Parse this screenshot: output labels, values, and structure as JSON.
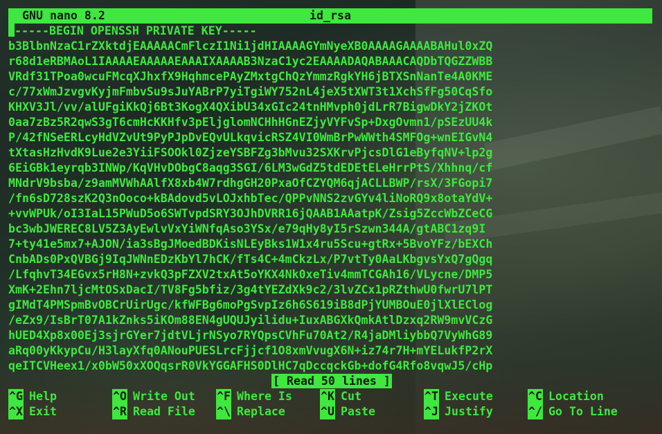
{
  "titlebar": {
    "app": "GNU nano 8.2",
    "filename": "id_rsa"
  },
  "editor": {
    "lines": [
      "-----BEGIN OPENSSH PRIVATE KEY-----",
      "b3BlbnNzaC1rZXktdjEAAAAACmFlczI1Ni1jdHIAAAAGYmNyeXB0AAAAGAAAABAHul0xZQ",
      "r68d1eRBMAoL1IAAAAEAAAAAEAAAIXAAAAB3NzaC1yc2EAAAADAQABAAACAQDbTQGZZWBB",
      "VRdf31TPoa0wcuFMcqXJhxfX9HqhmcePAyZMxtgChQzYmmzRgkYH6jBTXSnNanTe4A0KME",
      "c/77xWmJzvgvKyjmFmbvSu9sJuYABrP7yiTgiWY752nL4jeX5tXWT3t1XchSfFg50CqSfo",
      "KHXV3Jl/vv/alUFgiKkQj6Bt3KogX4QXibU34xGIc24tnHMvph0jdLrR7BigwDkY2jZKOt",
      "0aa7zBz5R2qwS3gT6cmHcKKHfv3pEljglomNCHhHGnEZjyVYFvSp+DxgOvmn1/pSEzUU4k",
      "P/42fNSeERLcyHdVZvUt9PyPJpDvEQvULkqvicRSZ4VI0WmBrPwWWth4SMFOg+wnEIGvN4",
      "tXtasHzHvdK9Lue2e3YiiFSOOkl0ZjzeYSBFZg3bMvu32SXKrvPjcsDlG1eByfqNV+lp2g",
      "6EiGBk1eyrqb3INWp/KqVHvDObgC8aqg3SGI/6LM3wGdZ5tdEDEtELeHrrPtS/Xhhnq/cf",
      "MNdrV9bsba/z9amMVWhAAlfX8xb4W7rdhgGH20PxaOfCZYQM6qjACLLBWP/rsX/3FGopi7",
      "/fn6sD728szK2Q3nOoco+kBAdovd5vLOJxhbTec/QPPvNNS2zvGYv4liNoRQ9x8otaYdV+",
      "+vvWPUk/oI3IaL15PWuD5o6SWTvpdSRY3OJhDVRR16jQAAB1AAatpK/Zsig5ZccWbZCeCG",
      "bc3wbJWEREC8LV5Z3AyEwlvVxYiWNfqAso3YSx/e79qHy8yI5rSzwn344A/gtABC1zq9I",
      "7+ty41e5mx7+AJON/ia3sBgJMoedBDKisNLEyBks1W1x4ru5Scu+gtRx+5BvoYFz/bEXCh",
      "CnbADs0PxQVBGj9IqJWNnEDzKbYl7hCK/fTs4C+4mCkzLx/P7vtTy0AaLKbgvsYxQ7gQgq",
      "/LfqhvT34EGvx5rH8N+zvkQ3pFZXV2txAt5oYKX4Nk0xeTiv4mmTCGAh16/VLycne/DMP5",
      "XmK+2Ehn7ljcMtOSxDacI/TV8Fg5bfiz/3g4tYEZdXk9c2/3lvZCx1pRZthwU0fwrU7lPT",
      "gIMdT4PMSpmBvOBCrUirUgc/kfWFBg6moPgSvpIz6h6S619iB8dPjYUMBOuE0jlXlEClog",
      "/eZx9/IsBrT07A1kZnks5iKOm88EN4gUQUJyilidu+IuxABGXkQmkAtlDzxq2RW9mvVCzG",
      "hUED4Xp8x00Ej3sjrGYer7jdtVLjrNSyo7RYQpsCVhFu70At2/R4jaDMliybbQ7VyWhG89",
      "aRq00yKkypCu/H3layXfq0ANouPUESLrcFjjcf1O8xmVvugX6N+iz74r7H+mYELukfP2rX",
      "qeITCVHeex1/x0bW50xXOQqsrR0VkYGGAFHS0DlHC7qDccqckGb+dofG4Rfo8vqwJ5/cHp"
    ]
  },
  "status": {
    "message": "[ Read 50 lines ]"
  },
  "shortcuts": [
    {
      "key": "^G",
      "label": "Help"
    },
    {
      "key": "^O",
      "label": "Write Out"
    },
    {
      "key": "^F",
      "label": "Where Is"
    },
    {
      "key": "^K",
      "label": "Cut"
    },
    {
      "key": "^T",
      "label": "Execute"
    },
    {
      "key": "^C",
      "label": "Location"
    },
    {
      "key": "^X",
      "label": "Exit"
    },
    {
      "key": "^R",
      "label": "Read File"
    },
    {
      "key": "^\\",
      "label": "Replace"
    },
    {
      "key": "^U",
      "label": "Paste"
    },
    {
      "key": "^J",
      "label": "Justify"
    },
    {
      "key": "^/",
      "label": "Go To Line"
    }
  ],
  "colors": {
    "foreground": "#3ee83e",
    "inverse_text": "#0f1a0f"
  }
}
